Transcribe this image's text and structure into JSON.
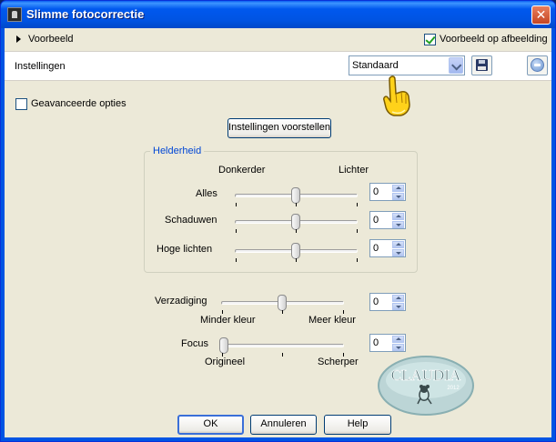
{
  "window": {
    "title": "Slimme fotocorrectie",
    "close_symbol": "✕"
  },
  "preview": {
    "label": "Voorbeeld",
    "on_image_label": "Voorbeeld op afbeelding",
    "on_image_checked": true
  },
  "settings": {
    "label": "Instellingen",
    "preset_value": "Standaard",
    "save_icon": "floppy-disk-icon",
    "reset_icon": "reset-icon"
  },
  "advanced": {
    "label": "Geavanceerde opties",
    "checked": false
  },
  "suggest_button": "Instellingen voorstellen",
  "brightness": {
    "legend": "Helderheid",
    "darker": "Donkerder",
    "lighter": "Lichter",
    "sliders": [
      {
        "label": "Alles",
        "value": "0"
      },
      {
        "label": "Schaduwen",
        "value": "0"
      },
      {
        "label": "Hoge lichten",
        "value": "0"
      }
    ]
  },
  "saturation": {
    "label": "Verzadiging",
    "value": "0",
    "min_label": "Minder kleur",
    "max_label": "Meer kleur"
  },
  "focus": {
    "label": "Focus",
    "value": "0",
    "min_label": "Origineel",
    "max_label": "Scherper"
  },
  "watermark": {
    "name": "CLAUDIA",
    "year": "2012"
  },
  "buttons": {
    "ok": "OK",
    "cancel": "Annuleren",
    "help": "Help"
  }
}
